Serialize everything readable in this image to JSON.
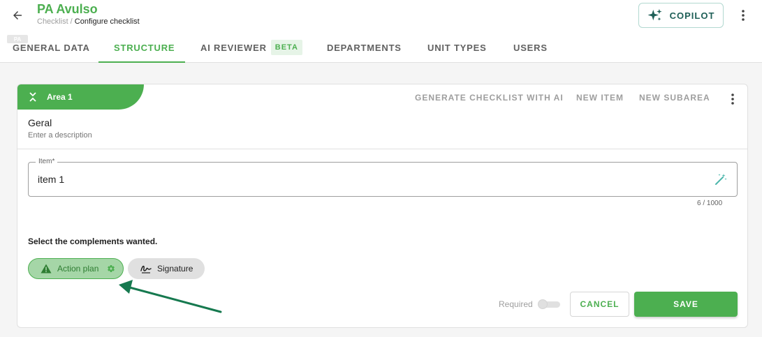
{
  "header": {
    "title": "PA Avulso",
    "breadcrumb_parent": "Checklist",
    "breadcrumb_separator": " / ",
    "breadcrumb_current": "Configure checklist",
    "copilot_label": "COPILOT",
    "small_tag": "PA"
  },
  "tabs": [
    {
      "label": "GENERAL DATA",
      "active": false
    },
    {
      "label": "STRUCTURE",
      "active": true
    },
    {
      "label": "AI REVIEWER",
      "badge": "BETA",
      "active": false
    },
    {
      "label": "DEPARTMENTS",
      "active": false
    },
    {
      "label": "UNIT TYPES",
      "active": false
    },
    {
      "label": "USERS",
      "active": false
    }
  ],
  "area": {
    "title": "Area 1",
    "actions": {
      "generate": "GENERATE CHECKLIST WITH AI",
      "new_item": "NEW ITEM",
      "new_subarea": "NEW SUBAREA"
    },
    "section_title": "Geral",
    "section_description": "Enter a description"
  },
  "item_field": {
    "label": "Item*",
    "value": "item 1",
    "counter": "6 / 1000"
  },
  "complements": {
    "label": "Select the complements wanted.",
    "chips": [
      {
        "label": "Action plan",
        "selected": true
      },
      {
        "label": "Signature",
        "selected": false
      }
    ]
  },
  "footer": {
    "required_label": "Required",
    "required_on": false,
    "cancel_label": "CANCEL",
    "save_label": "SAVE"
  },
  "colors": {
    "brand_green": "#4caf50",
    "copilot_teal": "#1e5f57",
    "annotation_arrow": "#16794f"
  },
  "icons": [
    "arrow-left-icon",
    "sparkle-icon",
    "more-vertical-icon",
    "collapse-icon",
    "magic-wand-icon",
    "warning-icon",
    "settings-icon",
    "signature-icon"
  ]
}
